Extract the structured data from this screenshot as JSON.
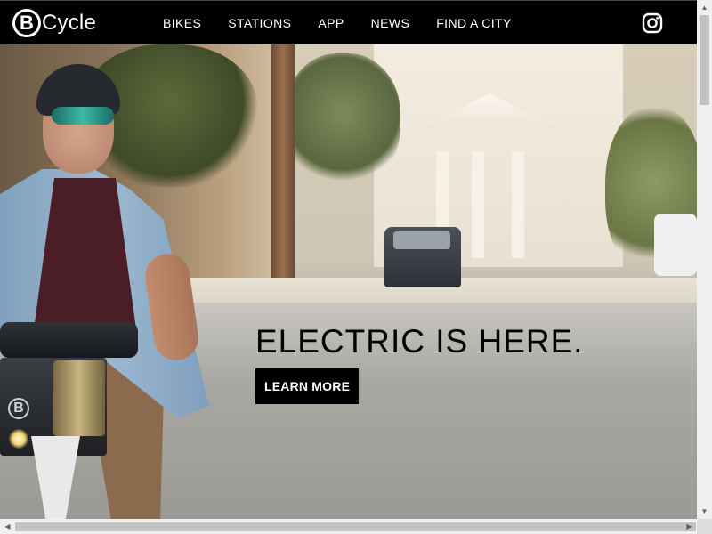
{
  "brand": {
    "logo_letter": "B",
    "logo_text": "Cycle"
  },
  "nav": {
    "items": [
      {
        "label": "BIKES"
      },
      {
        "label": "STATIONS"
      },
      {
        "label": "APP"
      },
      {
        "label": "NEWS"
      },
      {
        "label": "FIND A CITY"
      }
    ],
    "social_icon": "instagram-icon"
  },
  "hero": {
    "headline": "ELECTRIC IS HERE.",
    "cta_label": "LEARN MORE",
    "bike_badge": "B"
  },
  "colors": {
    "nav_bg": "#000000",
    "nav_text": "#ffffff",
    "cta_bg": "#000000",
    "cta_text": "#ffffff"
  },
  "scrollbars": {
    "up": "▲",
    "down": "▼",
    "left": "◀",
    "right": "▶"
  }
}
